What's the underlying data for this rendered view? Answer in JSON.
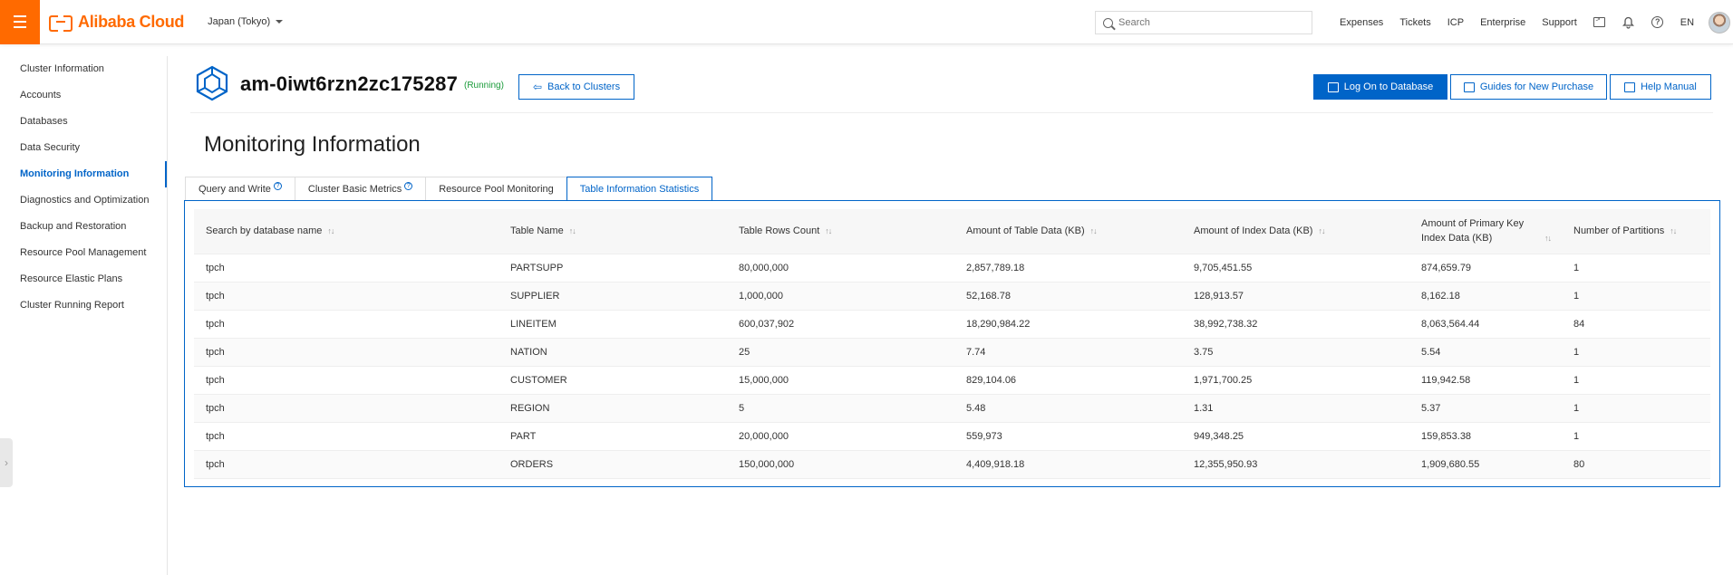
{
  "topbar": {
    "brand": "Alibaba Cloud",
    "region": "Japan (Tokyo)",
    "search_placeholder": "Search",
    "nav": [
      "Expenses",
      "Tickets",
      "ICP",
      "Enterprise",
      "Support"
    ],
    "lang": "EN",
    "accent_color": "#ff6a00"
  },
  "sidebar": {
    "items": [
      {
        "label": "Cluster Information",
        "active": false
      },
      {
        "label": "Accounts",
        "active": false
      },
      {
        "label": "Databases",
        "active": false
      },
      {
        "label": "Data Security",
        "active": false
      },
      {
        "label": "Monitoring Information",
        "active": true
      },
      {
        "label": "Diagnostics and Optimization",
        "active": false
      },
      {
        "label": "Backup and Restoration",
        "active": false
      },
      {
        "label": "Resource Pool Management",
        "active": false
      },
      {
        "label": "Resource Elastic Plans",
        "active": false
      },
      {
        "label": "Cluster Running Report",
        "active": false
      }
    ]
  },
  "header": {
    "cluster_id": "am-0iwt6rzn2zc175287",
    "status": "(Running)",
    "back_button": "Back to Clusters",
    "login_button": "Log On to Database",
    "guides_button": "Guides for New Purchase",
    "help_button": "Help Manual"
  },
  "page": {
    "title": "Monitoring Information",
    "tabs": [
      {
        "label": "Query and Write",
        "help": true,
        "active": false
      },
      {
        "label": "Cluster Basic Metrics",
        "help": true,
        "active": false
      },
      {
        "label": "Resource Pool Monitoring",
        "help": false,
        "active": false
      },
      {
        "label": "Table Information Statistics",
        "help": false,
        "active": true
      }
    ]
  },
  "table": {
    "columns": [
      "Search by database name",
      "Table Name",
      "Table Rows Count",
      "Amount of Table Data (KB)",
      "Amount of Index Data (KB)",
      "Amount of Primary Key Index Data (KB)",
      "Number of Partitions"
    ],
    "rows": [
      [
        "tpch",
        "PARTSUPP",
        "80,000,000",
        "2,857,789.18",
        "9,705,451.55",
        "874,659.79",
        "1"
      ],
      [
        "tpch",
        "SUPPLIER",
        "1,000,000",
        "52,168.78",
        "128,913.57",
        "8,162.18",
        "1"
      ],
      [
        "tpch",
        "LINEITEM",
        "600,037,902",
        "18,290,984.22",
        "38,992,738.32",
        "8,063,564.44",
        "84"
      ],
      [
        "tpch",
        "NATION",
        "25",
        "7.74",
        "3.75",
        "5.54",
        "1"
      ],
      [
        "tpch",
        "CUSTOMER",
        "15,000,000",
        "829,104.06",
        "1,971,700.25",
        "119,942.58",
        "1"
      ],
      [
        "tpch",
        "REGION",
        "5",
        "5.48",
        "1.31",
        "5.37",
        "1"
      ],
      [
        "tpch",
        "PART",
        "20,000,000",
        "559,973",
        "949,348.25",
        "159,853.38",
        "1"
      ],
      [
        "tpch",
        "ORDERS",
        "150,000,000",
        "4,409,918.18",
        "12,355,950.93",
        "1,909,680.55",
        "80"
      ]
    ]
  }
}
